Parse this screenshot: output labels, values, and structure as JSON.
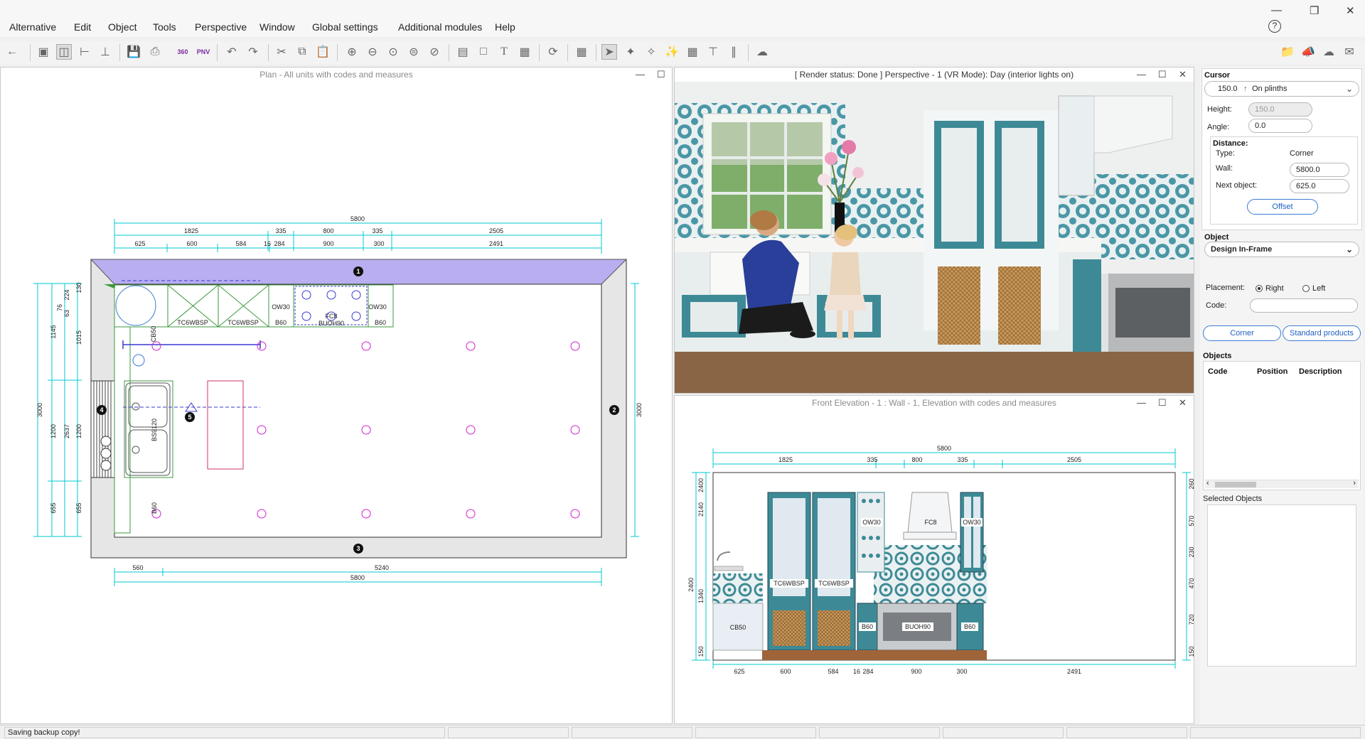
{
  "menu": [
    "Alternative",
    "Edit",
    "Object",
    "Tools",
    "Perspective",
    "Window",
    "Global settings",
    "Additional modules",
    "Help"
  ],
  "plan": {
    "title": "Plan - All units with codes and measures",
    "dim_top_total": "5800",
    "dim_top_row1": [
      "1825",
      "335",
      "800",
      "335",
      "2505"
    ],
    "dim_top_row2": [
      "625",
      "600",
      "584",
      "16",
      "284",
      "900",
      "300",
      "2491"
    ],
    "dim_bottom_row1": [
      "560",
      "5240"
    ],
    "dim_bottom_total": "5800",
    "dim_left_outer": "3000",
    "dim_left_a": [
      "1145",
      "1200",
      "655"
    ],
    "dim_left_b": [
      "76",
      "63",
      "2637"
    ],
    "dim_left_c": [
      "224",
      "130",
      "1015",
      "1200",
      "655"
    ],
    "dim_right": "3000",
    "wall_numbers": [
      "1",
      "2",
      "3",
      "4",
      "5"
    ],
    "units": [
      "OW30",
      "OW30",
      "TC6WBSP",
      "TC6WBSP",
      "B60",
      "FC8",
      "BUOH90",
      "B60",
      "CB50",
      "BS9120",
      "B60"
    ]
  },
  "render": {
    "title": "[ Render status: Done ] Perspective - 1 (VR Mode): Day (interior lights on)"
  },
  "elevation": {
    "title": "Front Elevation - 1 : Wall - 1, Elevation with codes and measures",
    "dim_top_total": "5800",
    "dim_top_row1": [
      "1825",
      "335",
      "800",
      "335",
      "2505"
    ],
    "dim_bottom": [
      "625",
      "600",
      "584",
      "16",
      "284",
      "900",
      "300",
      "2491"
    ],
    "dim_left_a": [
      "2400",
      "2140",
      "1340",
      "150"
    ],
    "dim_left_b": "2400",
    "dim_right": [
      "260",
      "570",
      "230",
      "470",
      "720",
      "150"
    ],
    "labels": [
      "OW30",
      "FC8",
      "OW30",
      "TC6WBSP",
      "TC6WBSP",
      "CB50",
      "B60",
      "BUOH90",
      "B60"
    ]
  },
  "side": {
    "cursor_label": "Cursor",
    "cursor_value": "150.0",
    "cursor_mode": "On plinths",
    "height_label": "Height:",
    "height_value": "150.0",
    "angle_label": "Angle:",
    "angle_value": "0.0",
    "distance_label": "Distance:",
    "type_label": "Type:",
    "type_value": "Corner",
    "wall_label": "Wall:",
    "wall_value": "5800.0",
    "next_label": "Next object:",
    "next_value": "625.0",
    "offset_btn": "Offset",
    "object_label": "Object",
    "object_value": "Design In-Frame",
    "placement_label": "Placement:",
    "placement_right": "Right",
    "placement_left": "Left",
    "code_label": "Code:",
    "corner_btn": "Corner",
    "standard_btn": "Standard products",
    "objects_label": "Objects",
    "col_code": "Code",
    "col_position": "Position",
    "col_description": "Description",
    "selected_label": "Selected Objects"
  },
  "status": {
    "message": "Saving backup copy!"
  },
  "colors": {
    "dim": "#00c8d2",
    "wall_top": "#b8aef0",
    "unit_green": "#3c9a3c",
    "magenta": "#d020d0",
    "cabinet_teal": "#3d8a96"
  }
}
